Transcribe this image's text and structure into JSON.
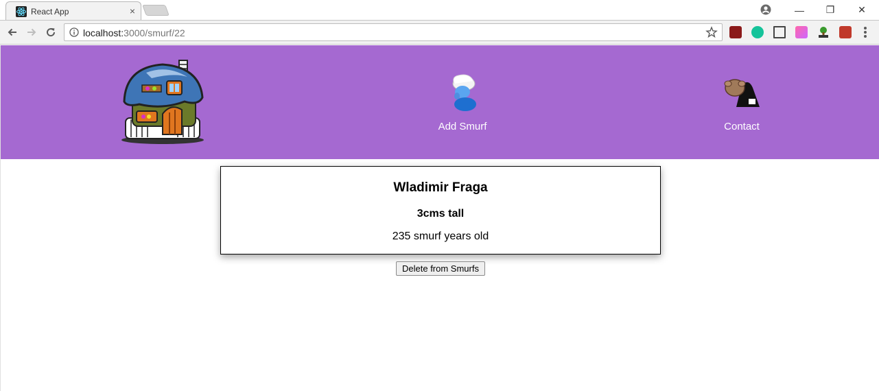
{
  "browser": {
    "tab_title": "React App",
    "tab_close": "×",
    "url_host": "localhost:",
    "url_path": "3000/smurf/22",
    "window_controls": {
      "minimize": "—",
      "restore": "❐",
      "close": "✕"
    },
    "extensions": [
      {
        "name": "acrobat-extension",
        "color": "#8b1a1a"
      },
      {
        "name": "grammarly-extension",
        "color": "#15c39a"
      },
      {
        "name": "screenshot-extension",
        "color": "#444444"
      },
      {
        "name": "color-extension",
        "color": "#e36bd2"
      },
      {
        "name": "html-tree-extension",
        "color": "#3a9a2d"
      },
      {
        "name": "puzzle-extension",
        "color": "#c0392b"
      }
    ]
  },
  "header": {
    "background": "#a569d1",
    "logo_icon": "mushroom-house-icon",
    "nav": [
      {
        "label": "Add Smurf",
        "icon": "smurf-hat-icon"
      },
      {
        "label": "Contact",
        "icon": "contact-smurf-icon"
      }
    ]
  },
  "smurf": {
    "name": "Wladimir Fraga",
    "height": "3cms tall",
    "age": "235 smurf years old"
  },
  "actions": {
    "delete_label": "Delete from Smurfs"
  }
}
